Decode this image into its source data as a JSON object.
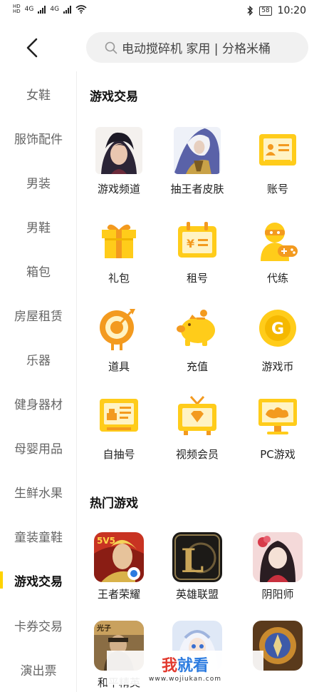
{
  "status_bar": {
    "hd_top": "HD",
    "hd_bottom": "HD",
    "net1": "4G",
    "net2": "4G",
    "battery": "58",
    "time": "10:20"
  },
  "search": {
    "placeholder": "电动搅碎机 家用 | 分格米桶"
  },
  "sidebar": {
    "items": [
      {
        "label": "女鞋"
      },
      {
        "label": "服饰配件"
      },
      {
        "label": "男装"
      },
      {
        "label": "男鞋"
      },
      {
        "label": "箱包"
      },
      {
        "label": "房屋租赁"
      },
      {
        "label": "乐器"
      },
      {
        "label": "健身器材"
      },
      {
        "label": "母婴用品"
      },
      {
        "label": "生鲜水果"
      },
      {
        "label": "童装童鞋"
      },
      {
        "label": "游戏交易"
      },
      {
        "label": "卡券交易"
      },
      {
        "label": "演出票"
      }
    ],
    "active_index": 11
  },
  "sections": {
    "game_trade": {
      "title": "游戏交易",
      "items": [
        {
          "label": "游戏频道",
          "icon": "hero-avatar-icon"
        },
        {
          "label": "抽王者皮肤",
          "icon": "skin-avatar-icon"
        },
        {
          "label": "账号",
          "icon": "id-card-icon"
        },
        {
          "label": "礼包",
          "icon": "gift-icon"
        },
        {
          "label": "租号",
          "icon": "calendar-yuan-icon"
        },
        {
          "label": "代练",
          "icon": "ninja-gamepad-icon"
        },
        {
          "label": "道具",
          "icon": "target-icon"
        },
        {
          "label": "充值",
          "icon": "piggy-bank-icon"
        },
        {
          "label": "游戏币",
          "icon": "coin-icon"
        },
        {
          "label": "自抽号",
          "icon": "ticket-card-icon"
        },
        {
          "label": "视频会员",
          "icon": "tv-icon"
        },
        {
          "label": "PC游戏",
          "icon": "monitor-game-icon"
        }
      ]
    },
    "hot_games": {
      "title": "热门游戏",
      "items": [
        {
          "label": "王者荣耀",
          "icon": "honor-of-kings-icon",
          "badge": "5V5"
        },
        {
          "label": "英雄联盟",
          "icon": "league-of-legends-icon",
          "badge": "L"
        },
        {
          "label": "阴阳师",
          "icon": "onmyoji-icon"
        },
        {
          "label": "和平精英",
          "icon": "peacekeeper-icon",
          "badge": "光子"
        },
        {
          "label": "",
          "icon": "anime-game-icon"
        },
        {
          "label": "",
          "icon": "hearthstone-icon"
        }
      ]
    }
  },
  "watermark": {
    "title_a": "我",
    "title_b": "就看",
    "url": "www.wojiukan.com"
  },
  "colors": {
    "accent": "#ffd300",
    "icon_yellow": "#ffcc1a",
    "icon_orange": "#f39a1f"
  }
}
